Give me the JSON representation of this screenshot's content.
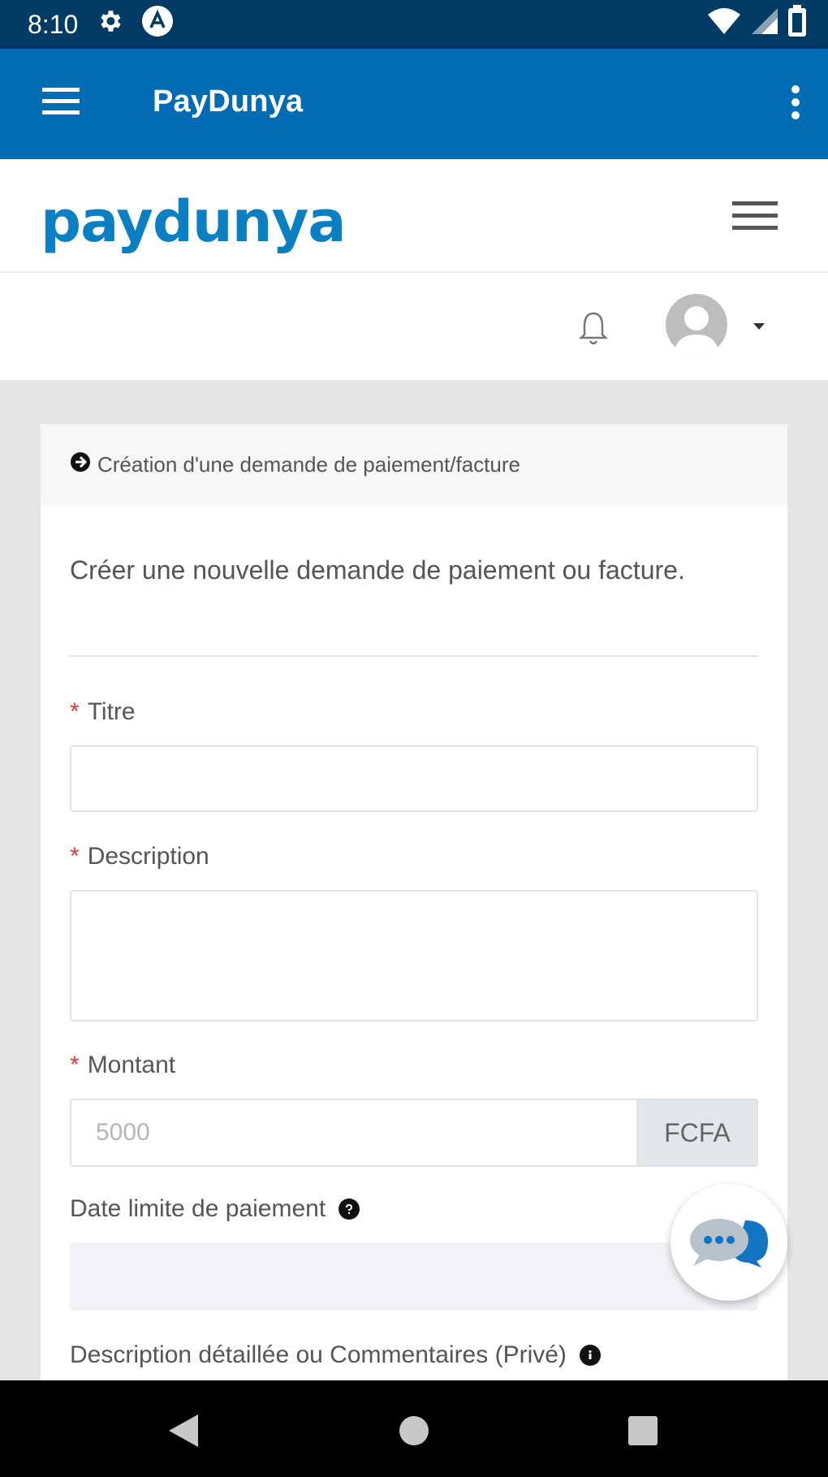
{
  "status_bar": {
    "time": "8:10"
  },
  "app_bar": {
    "title": "PayDunya"
  },
  "website": {
    "logo_text": "paydunya"
  },
  "card": {
    "header": "Création d'une demande de paiement/facture",
    "intro": "Créer une nouvelle demande de paiement ou facture.",
    "fields": {
      "title_label": "Titre",
      "description_label": "Description",
      "amount_label": "Montant",
      "amount_placeholder": "5000",
      "currency": "FCFA",
      "due_date_label": "Date limite de paiement",
      "comments_label": "Description détaillée ou Commentaires (Privé)",
      "required_marker": "*"
    }
  },
  "colors": {
    "status_bar": "#013a63",
    "app_bar": "#016bb3",
    "logo": "#0a7fc2",
    "required": "#e53935"
  }
}
